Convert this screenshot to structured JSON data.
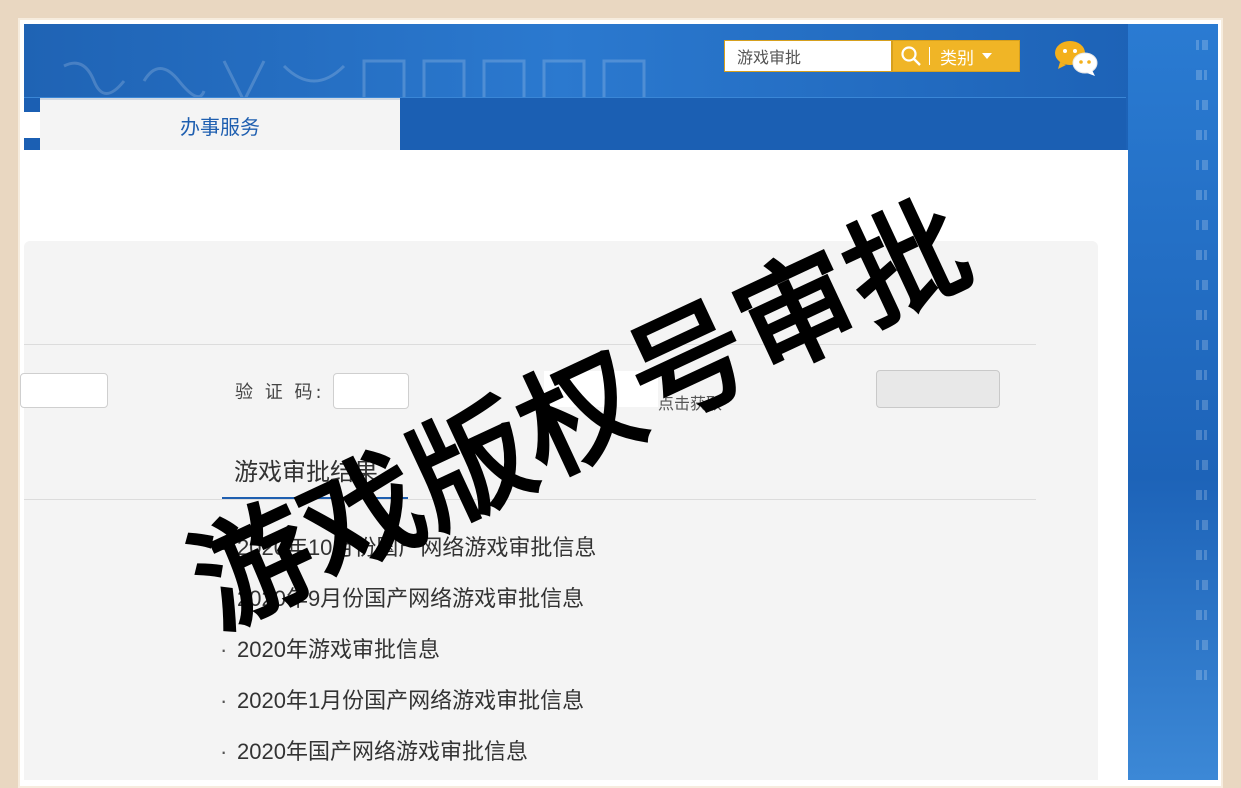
{
  "header": {
    "search": {
      "value": "游戏审批"
    },
    "category_label": "类别",
    "icons": {
      "search": "search-icon",
      "dropdown": "caret-down-icon",
      "wechat": "wechat-icon"
    },
    "colors": {
      "brand_blue": "#1f63b4",
      "accent_gold": "#f0b526"
    }
  },
  "nav": {
    "tabs": [
      {
        "label": "办事服务"
      }
    ]
  },
  "form": {
    "captcha_label": "验 证 码:",
    "captcha_link": "点击获取"
  },
  "results": {
    "title": "游戏审批结果",
    "items": [
      "2020年10月份国产网络游戏审批信息",
      "2020年9月份国产网络游戏审批信息",
      "2020年游戏审批信息",
      "2020年1月份国产网络游戏审批信息",
      "2020年国产网络游戏审批信息"
    ]
  },
  "overlay": {
    "watermark_text": "游戏版权号审批"
  }
}
